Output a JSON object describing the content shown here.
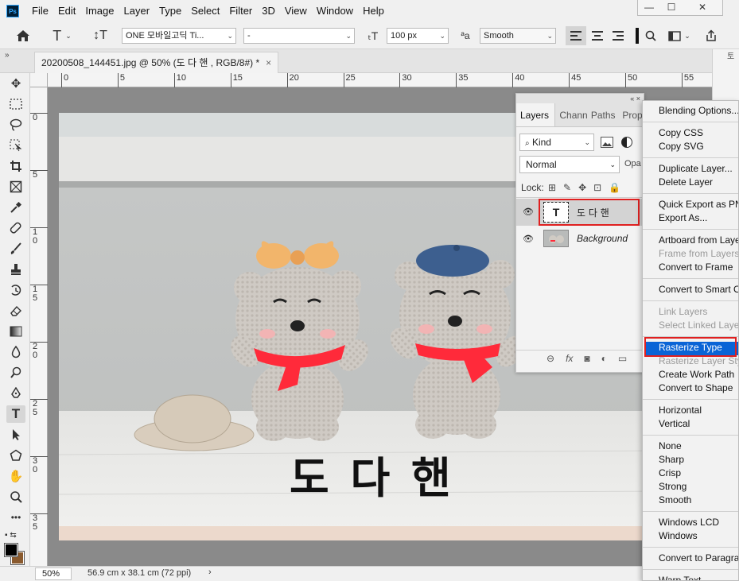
{
  "app": {
    "logo": "Ps"
  },
  "menubar": [
    "File",
    "Edit",
    "Image",
    "Layer",
    "Type",
    "Select",
    "Filter",
    "3D",
    "View",
    "Window",
    "Help"
  ],
  "window_controls": {
    "minimize": "—",
    "maximize": "☐",
    "close": "✕"
  },
  "options_bar": {
    "font_family": "ONE 모바일고딕 Ti...",
    "font_style": "-",
    "font_size": "100 px",
    "aa_label": "ªa",
    "anti_alias": "Smooth"
  },
  "doc_tab": {
    "title": "20200508_144451.jpg @ 50% (도 다 핸 , RGB/8#) *",
    "close": "×"
  },
  "ruler": {
    "h_ticks": [
      "0",
      "5",
      "10",
      "15",
      "20",
      "25",
      "30",
      "35",
      "40",
      "45",
      "50",
      "55"
    ],
    "v_ticks": [
      "0",
      "5",
      "1\n0",
      "1\n5",
      "2\n0",
      "2\n5",
      "3\n0",
      "3\n5"
    ]
  },
  "canvas": {
    "text_layer": "도 다 핸"
  },
  "status": {
    "zoom": "50%",
    "doc_size": "56.9 cm x 38.1 cm (72 ppi)",
    "arrow": "›"
  },
  "layers_panel": {
    "collapse": "« ×",
    "tabs": [
      "Layers",
      "Chann",
      "Paths",
      "Prop"
    ],
    "filter_kind": "Kind",
    "blend_mode": "Normal",
    "opacity_label": "Opa",
    "lock_label": "Lock:",
    "layers": [
      {
        "name": "도 다 핸",
        "type": "text",
        "thumb": "T"
      },
      {
        "name": "Background",
        "type": "image"
      }
    ]
  },
  "context_menu": {
    "groups": [
      [
        "Blending Options..."
      ],
      [
        "Copy CSS",
        "Copy SVG"
      ],
      [
        "Duplicate Layer...",
        "Delete Layer"
      ],
      [
        "Quick Export as PNG",
        "Export As..."
      ],
      [
        "Artboard from Layers...",
        "Frame from Layers...",
        "Convert to Frame"
      ],
      [
        "Convert to Smart Object"
      ],
      [
        "Link Layers",
        "Select Linked Layers"
      ],
      [
        "Rasterize Type",
        "Rasterize Layer Style",
        "Create Work Path",
        "Convert to Shape"
      ],
      [
        "Horizontal",
        "Vertical"
      ],
      [
        "None",
        "Sharp",
        "Crisp",
        "Strong",
        "Smooth"
      ],
      [
        "Windows LCD",
        "Windows"
      ],
      [
        "Convert to Paragraph Text"
      ],
      [
        "Warp Text..."
      ]
    ],
    "disabled": [
      "Frame from Layers...",
      "Link Layers",
      "Select Linked Layers",
      "Rasterize Layer Style"
    ],
    "highlighted": "Rasterize Type"
  },
  "colors": {
    "highlight": "#0a64d6",
    "annotation_box": "#e02020",
    "scarf": "#ff2a3a",
    "bow": "#f2b56b",
    "beret": "#3d5f8f"
  }
}
